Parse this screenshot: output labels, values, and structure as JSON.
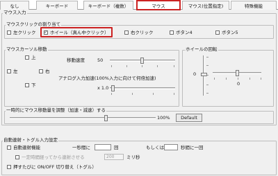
{
  "tabs": [
    {
      "label": "なし"
    },
    {
      "label": "キーボード"
    },
    {
      "label": "キーボード（複数）"
    },
    {
      "label": "マウス"
    },
    {
      "label": "マウス(位置指定)"
    },
    {
      "label": "特殊機能"
    }
  ],
  "mouse_input": {
    "title": "マウス入力",
    "click_group": {
      "title": "マウスクリックの割り当て",
      "options": [
        {
          "label": "左クリック",
          "checked": false
        },
        {
          "label": "ホイール（真ん中クリック）",
          "checked": true
        },
        {
          "label": "右クリック",
          "checked": false
        },
        {
          "label": "ボタン4",
          "checked": false
        },
        {
          "label": "ボタン5",
          "checked": false
        }
      ]
    },
    "cursor_group": {
      "title": "マウスカーソル移動",
      "up": "上",
      "left": "左",
      "right": "右",
      "down": "下",
      "speed_label": "移動速度",
      "speed_value": "50",
      "analog_label": "アナログ入力加速(100%入力に向けて何倍加速)",
      "analog_value": "x 1.0"
    },
    "wheel_group": {
      "title": "ホイールの回転",
      "v_value": "0",
      "h_value": "0"
    },
    "temp_adjust": {
      "label": "一時的にマウス移動量を調整（加速・減速）する",
      "value": "100%",
      "default_button": "Default"
    }
  },
  "auto_repeat": {
    "title": "自動連射・トグル入力設定",
    "auto_fire_label": "自動連射機能",
    "per_second_label": "一秒間に",
    "times_unit": "回",
    "or_label": "もしくは",
    "once_per_label": "秒間に一回",
    "delay_label": "一定時間経ってから連射させる",
    "delay_value": "200",
    "ms_unit": "ミリ秒",
    "toggle_label": "押すたびに ON/OFF 切り替え（トグル）"
  }
}
